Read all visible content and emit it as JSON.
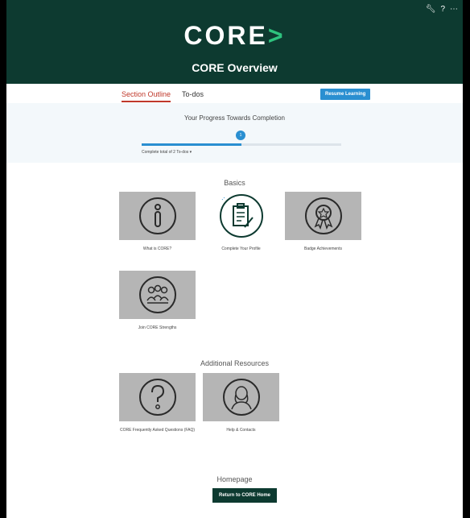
{
  "header": {
    "logo": "CORE",
    "logo_chevron": ">",
    "title": "CORE Overview"
  },
  "toolbar_icons": [
    "wrench-icon",
    "help-icon",
    "more-icon"
  ],
  "tabs": [
    {
      "label": "Section Outline",
      "active": true
    },
    {
      "label": "To-dos",
      "active": false
    }
  ],
  "resume_label": "Resume Learning",
  "progress": {
    "title": "Your Progress Towards Completion",
    "marker": "1",
    "fraction": 0.5,
    "complete_text": "Complete total of 2 To-dos"
  },
  "sections": {
    "basics": {
      "title": "Basics",
      "cards": [
        {
          "label": "What is CORE?"
        },
        {
          "label": "Complete Your Profile"
        },
        {
          "label": "Badge Achievements"
        },
        {
          "label": "Join CORE Strengths"
        }
      ]
    },
    "resources": {
      "title": "Additional Resources",
      "cards": [
        {
          "label": "CORE Frequently Asked Questions (FAQ)"
        },
        {
          "label": "Help & Contacts"
        }
      ]
    },
    "homepage": {
      "title": "Homepage",
      "button": "Return to CORE Home"
    }
  },
  "colors": {
    "header": "#0d3a30",
    "accent": "#2a8fd1",
    "green": "#2ec27e",
    "tab_active": "#c0392b"
  }
}
